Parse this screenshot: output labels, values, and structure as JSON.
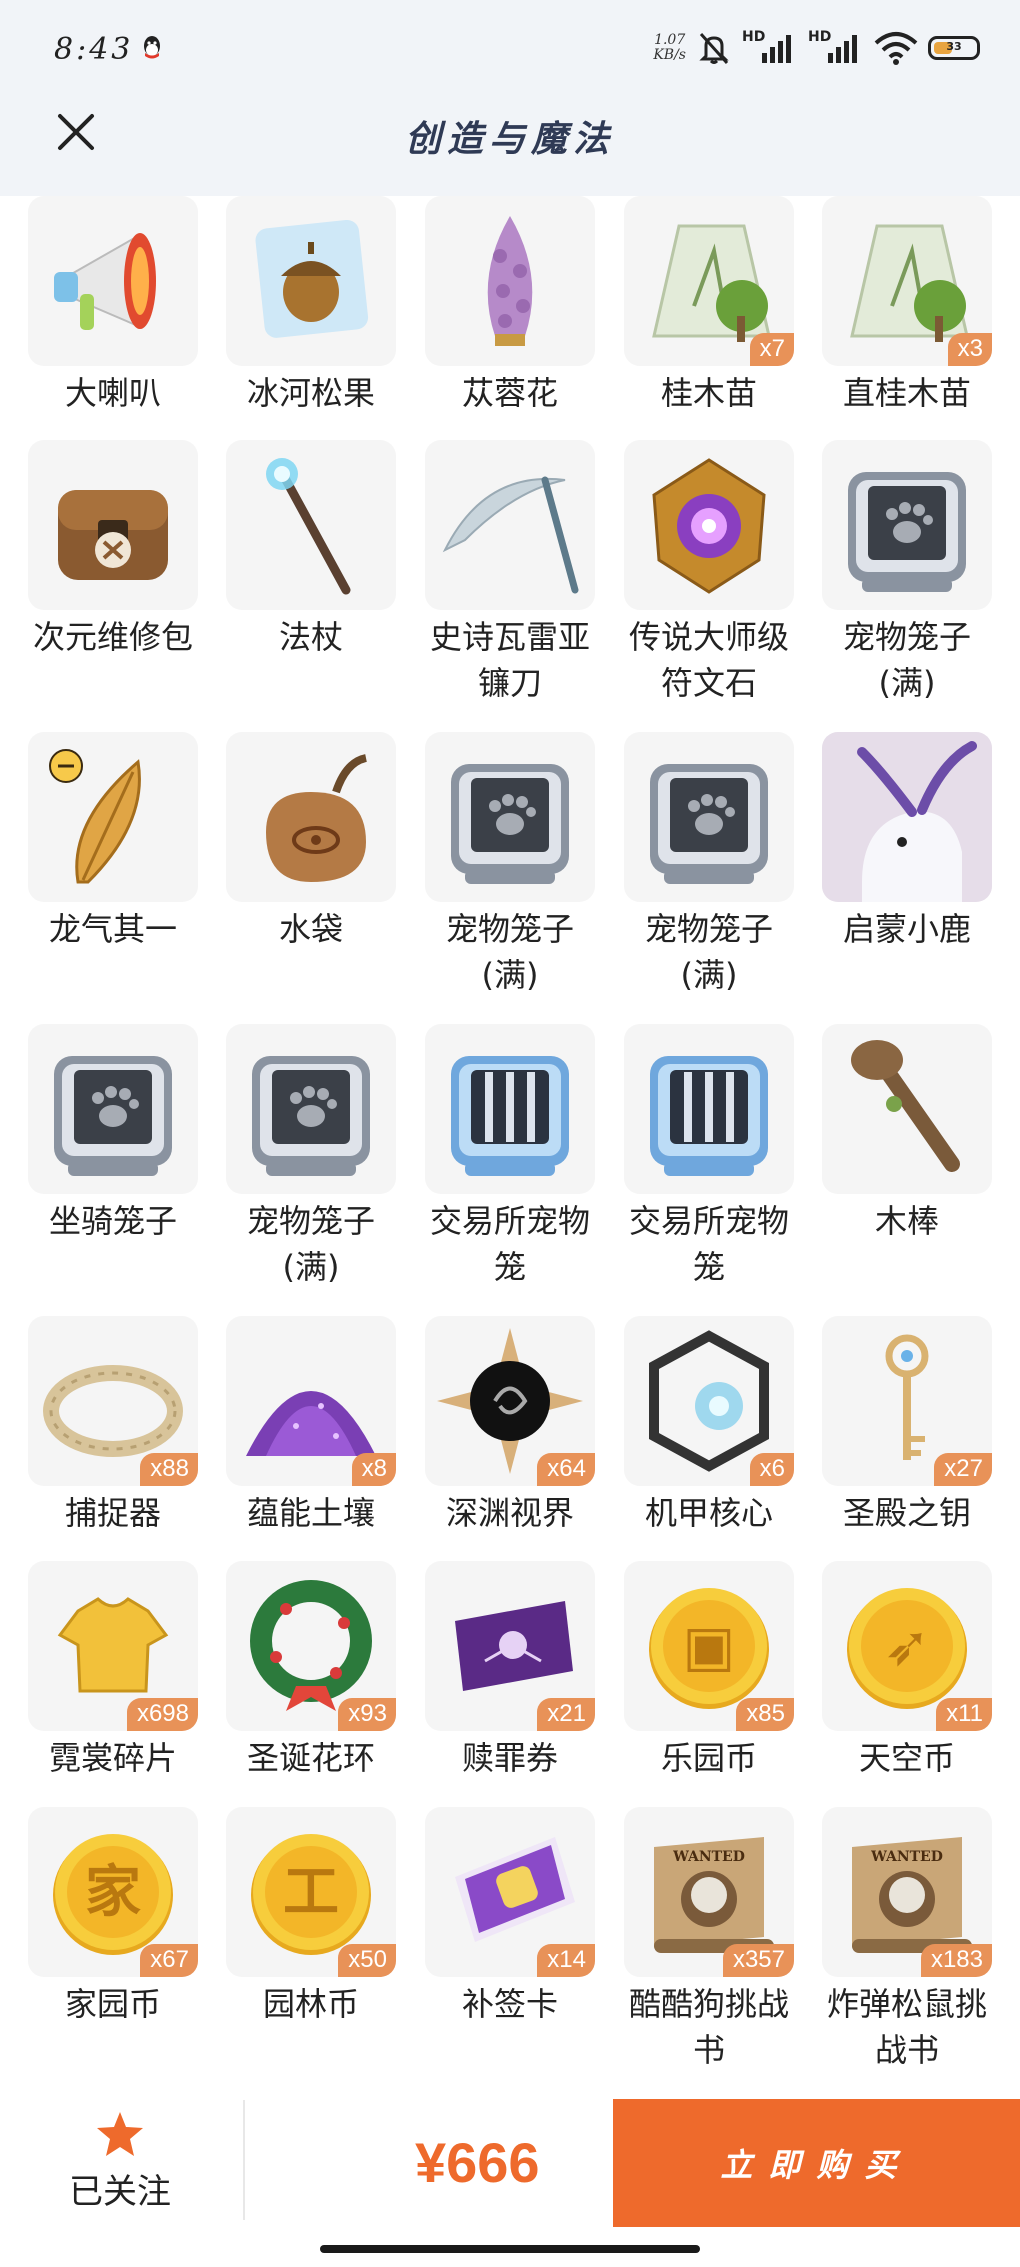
{
  "status_bar": {
    "time": "8:43",
    "net_speed_value": "1.07",
    "net_speed_unit": "KB/s",
    "signal_1_label": "HD",
    "signal_2_label": "HD",
    "battery_level": "33"
  },
  "header": {
    "title": "创造与魔法",
    "close_icon": "close-icon"
  },
  "items": [
    {
      "name": "大喇叭",
      "icon": "megaphone",
      "count": ""
    },
    {
      "name": "冰河松果",
      "icon": "ice-acorn",
      "count": ""
    },
    {
      "name": "苁蓉花",
      "icon": "flower-cone",
      "count": ""
    },
    {
      "name": "桂木苗",
      "icon": "sapling-bag",
      "count": "x7"
    },
    {
      "name": "直桂木苗",
      "icon": "sapling-bag",
      "count": "x3"
    },
    {
      "name": "次元维修包",
      "icon": "repair-bag",
      "count": ""
    },
    {
      "name": "法杖",
      "icon": "staff",
      "count": ""
    },
    {
      "name": "史诗瓦雷亚\n镰刀",
      "icon": "scythe",
      "count": ""
    },
    {
      "name": "传说大师级\n符文石",
      "icon": "rune-stone",
      "count": ""
    },
    {
      "name": "宠物笼子\n(满)",
      "icon": "pet-cage",
      "count": ""
    },
    {
      "name": "龙气其一",
      "icon": "dragon-feather",
      "count": ""
    },
    {
      "name": "水袋",
      "icon": "water-bag",
      "count": ""
    },
    {
      "name": "宠物笼子\n(满)",
      "icon": "pet-cage",
      "count": ""
    },
    {
      "name": "宠物笼子\n(满)",
      "icon": "pet-cage",
      "count": ""
    },
    {
      "name": "启蒙小鹿",
      "icon": "deer",
      "count": ""
    },
    {
      "name": "坐骑笼子",
      "icon": "mount-cage",
      "count": ""
    },
    {
      "name": "宠物笼子\n(满)",
      "icon": "pet-cage",
      "count": ""
    },
    {
      "name": "交易所宠物\n笼",
      "icon": "trade-cage",
      "count": ""
    },
    {
      "name": "交易所宠物\n笼",
      "icon": "trade-cage",
      "count": ""
    },
    {
      "name": "木棒",
      "icon": "club",
      "count": ""
    },
    {
      "name": "捕捉器",
      "icon": "thorn-ring",
      "count": "x88"
    },
    {
      "name": "蕴能土壤",
      "icon": "soil-pile",
      "count": "x8"
    },
    {
      "name": "深渊视界",
      "icon": "abyss-sun",
      "count": "x64"
    },
    {
      "name": "机甲核心",
      "icon": "mech-core",
      "count": "x6"
    },
    {
      "name": "圣殿之钥",
      "icon": "key",
      "count": "x27"
    },
    {
      "name": "霓裳碎片",
      "icon": "shirt",
      "count": "x698"
    },
    {
      "name": "圣诞花环",
      "icon": "wreath",
      "count": "x93"
    },
    {
      "name": "赎罪券",
      "icon": "ticket",
      "count": "x21"
    },
    {
      "name": "乐园币",
      "icon": "coin-chest",
      "count": "x85"
    },
    {
      "name": "天空币",
      "icon": "coin-bow",
      "count": "x11"
    },
    {
      "name": "家园币",
      "icon": "coin-home",
      "count": "x67"
    },
    {
      "name": "园林币",
      "icon": "coin-garden",
      "count": "x50"
    },
    {
      "name": "补签卡",
      "icon": "sign-card",
      "count": "x14"
    },
    {
      "name": "酷酷狗挑战\n书",
      "icon": "wanted-scroll",
      "count": "x357"
    },
    {
      "name": "炸弹松鼠挑\n战书",
      "icon": "wanted-scroll",
      "count": "x183"
    }
  ],
  "wanted_text": "WANTED",
  "bottom_bar": {
    "follow_label": "已关注",
    "price": "¥666",
    "buy_label": "立即购买"
  },
  "colors": {
    "accent": "#ee6a2c",
    "badge": "#e89258",
    "header_bg": "#f1f4f8",
    "title": "#2f3a55"
  }
}
